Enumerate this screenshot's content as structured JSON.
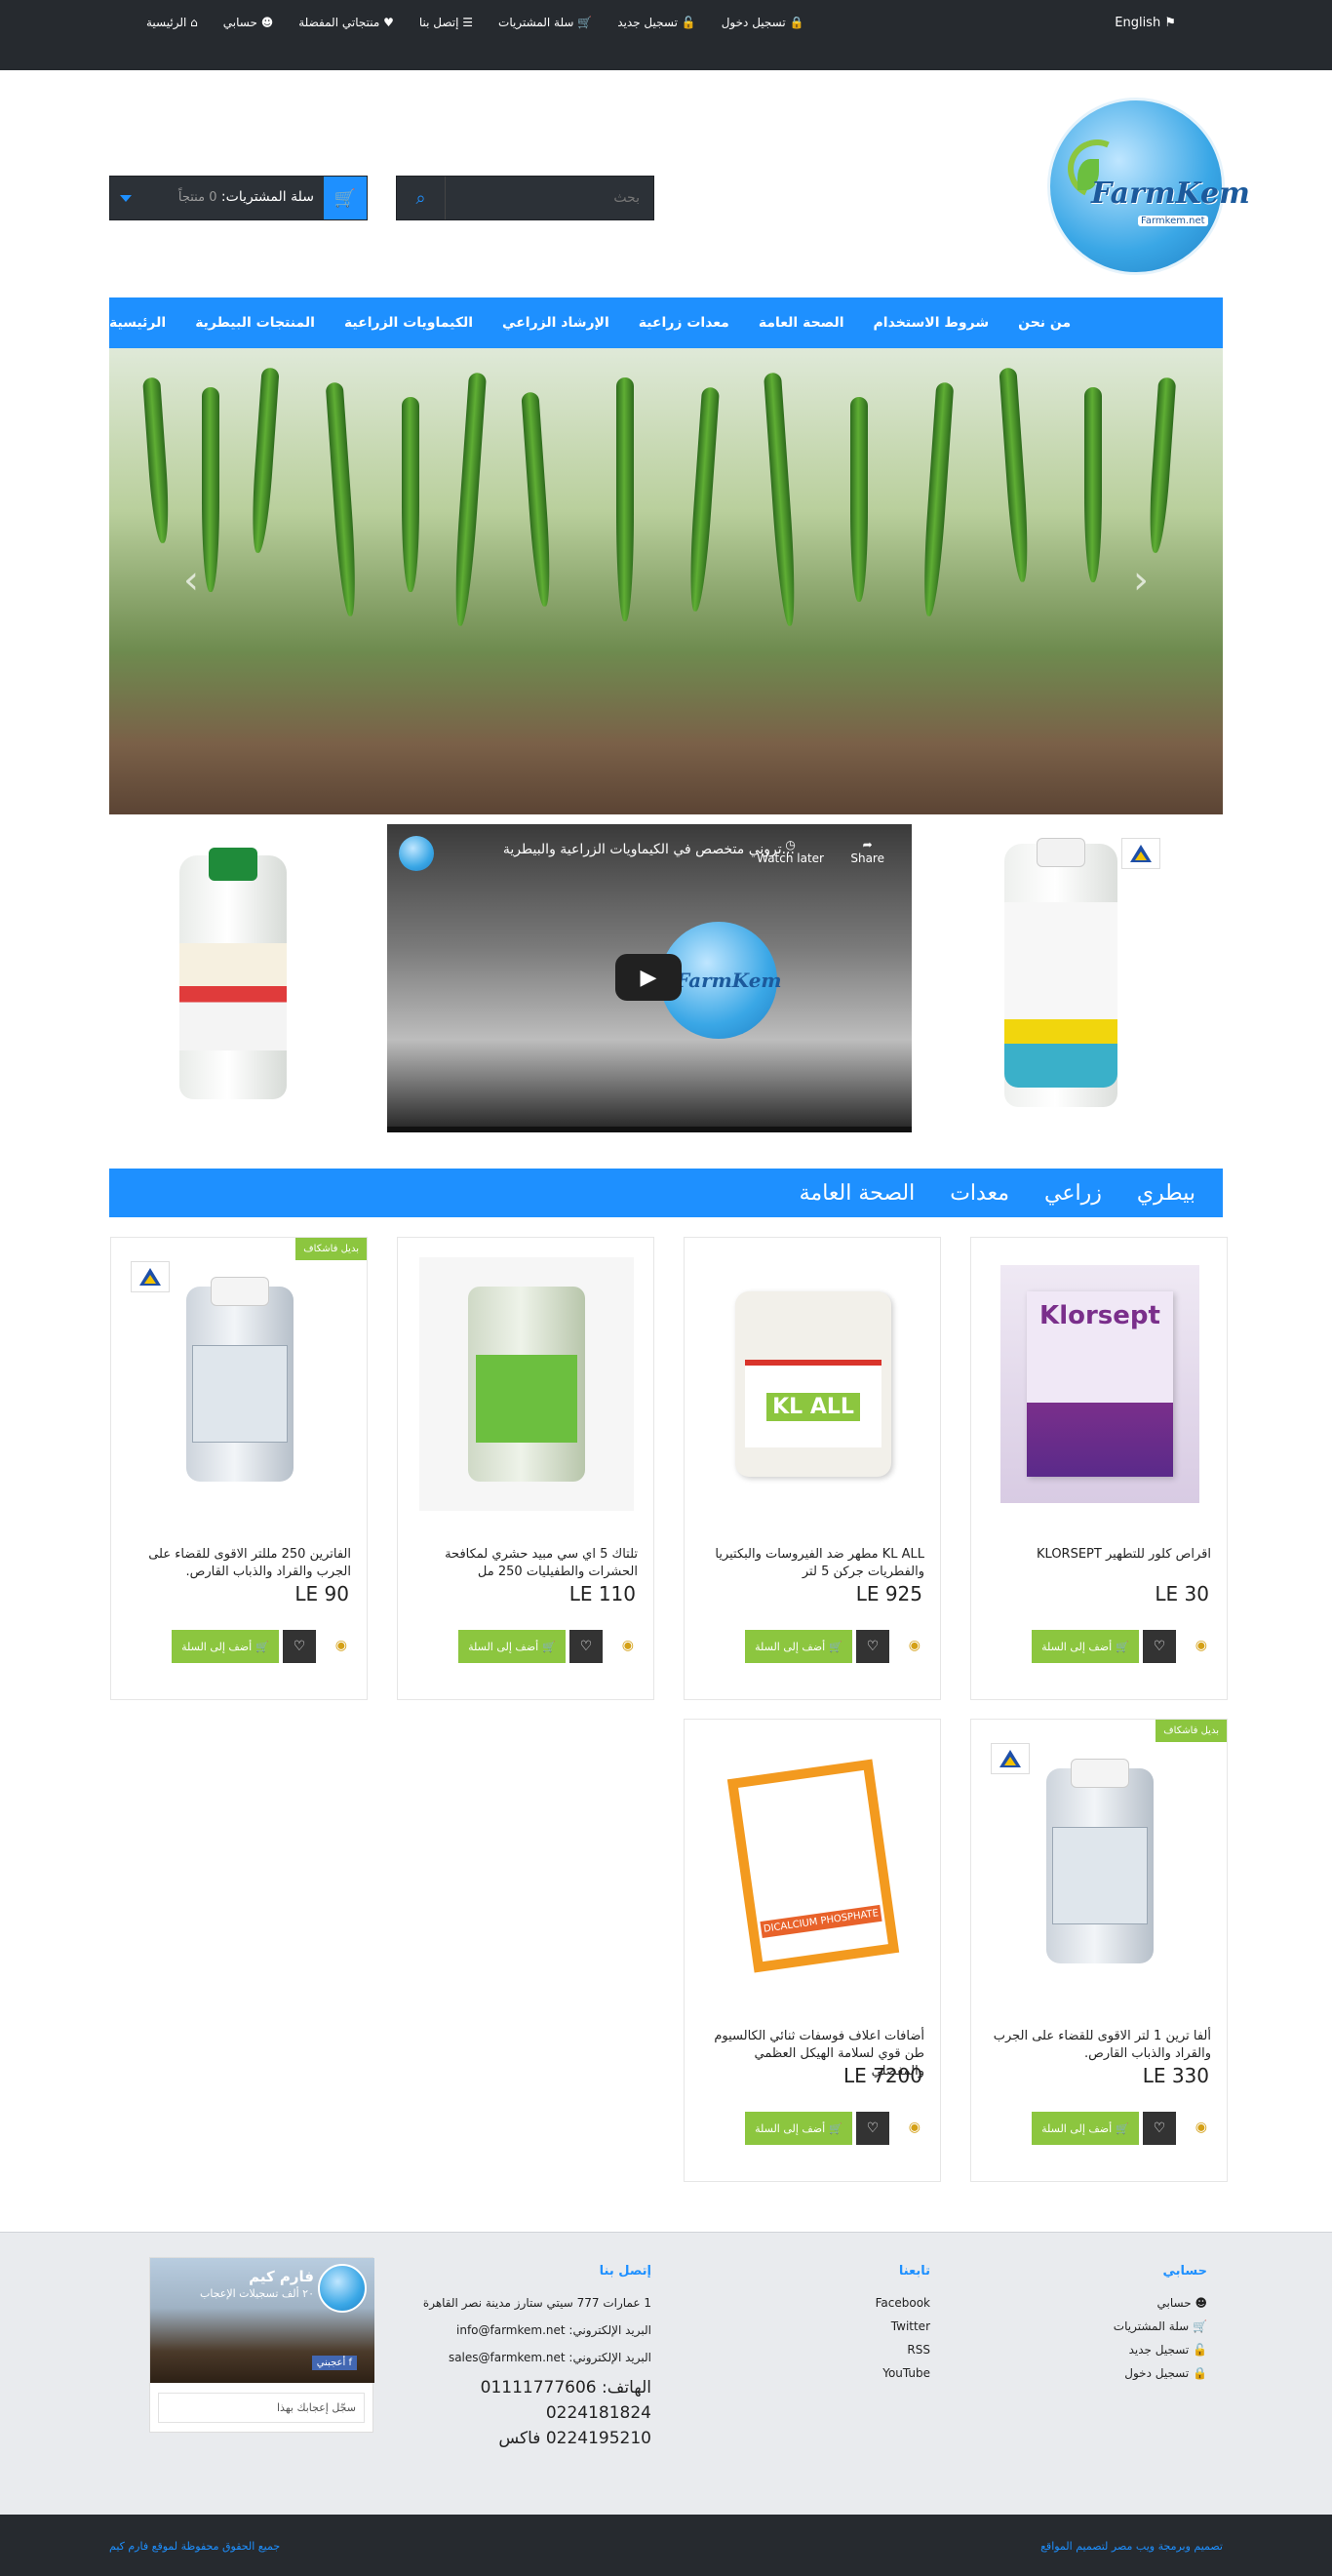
{
  "topbar": {
    "language": "English",
    "links": [
      {
        "label": "الرئيسية",
        "icon": "home-icon",
        "glyph": "⌂"
      },
      {
        "label": "حسابي",
        "icon": "user-icon",
        "glyph": "☻"
      },
      {
        "label": "منتجاتي المفضلة",
        "icon": "heart-icon",
        "glyph": "♥"
      },
      {
        "label": "إتصل بنا",
        "icon": "list-icon",
        "glyph": "☰"
      },
      {
        "label": "سلة المشتريات",
        "icon": "cart-icon",
        "glyph": "🛒"
      },
      {
        "label": "تسجيل جديد",
        "icon": "unlock-icon",
        "glyph": "🔓"
      },
      {
        "label": "تسجيل دخول",
        "icon": "lock-icon",
        "glyph": "🔒"
      }
    ]
  },
  "logo": {
    "text": "FarmKem",
    "subtext": "Farmkem.net"
  },
  "search": {
    "placeholder": "بحث"
  },
  "cart": {
    "label": "سلة المشتريات:",
    "count": "0 منتجاً"
  },
  "main_nav": [
    "الرئيسية",
    "المنتجات البيطرية",
    "الكيماويات الزراعية",
    "الإرشاد الزراعي",
    "معدات زراعية",
    "الصحة العامة",
    "شروط الاستخدام",
    "من نحن"
  ],
  "video": {
    "title": "...تروني متخصص في الكيماويات الزراعية والبيطرية",
    "watch_later": "Watch later",
    "share": "Share",
    "logo_text": "FarmKem"
  },
  "category_tabs": [
    "بيطري",
    "زراعي",
    "معدات",
    "الصحة العامة"
  ],
  "products": [
    {
      "name": "اقراص كلور للتطهير KLORSEPT",
      "price": "LE 30",
      "badge": "",
      "add_label": "أضف إلى السلة",
      "image_text": "Klorsept"
    },
    {
      "name": "KL ALL مطهر ضد الفيروسات والبكتيريا والفطريات جركن 5 لتر",
      "price": "LE 925",
      "badge": "",
      "add_label": "أضف إلى السلة",
      "image_text": "KL ALL"
    },
    {
      "name": "تلتاك 5 اي سي مبيد حشري لمكافحة الحشرات والطفيليات 250 مل",
      "price": "LE 110",
      "badge": "",
      "add_label": "أضف إلى السلة",
      "image_text": ""
    },
    {
      "name": "الفاترين 250 مللتر الاقوى للقضاء على الجرب والقراد والذباب القارص.",
      "price": "LE 90",
      "badge": "بديل فاشكاف",
      "add_label": "أضف إلى السلة",
      "image_text": ""
    },
    {
      "name": "ألفا ترين 1 لتر الاقوى للقضاء على الجرب والقراد والذباب القارص.",
      "price": "LE 330",
      "badge": "بديل فاشكاف",
      "add_label": "أضف إلى السلة",
      "image_text": ""
    },
    {
      "name": "أضافات اعلاف فوسفات ثنائي الكالسيوم طن قوي لسلامة الهيكل العظمي والمفصلي",
      "price": "LE 7200",
      "badge": "",
      "add_label": "أضف إلى السلة",
      "image_text": "DICALCIUM PHOSPHATE"
    }
  ],
  "footer": {
    "account": {
      "title": "حسابي",
      "links": [
        "حسابي",
        "سلة المشتريات",
        "تسجيل جديد",
        "تسجيل دخول"
      ]
    },
    "follow": {
      "title": "تابعنا",
      "links": [
        "Facebook",
        "Twitter",
        "RSS",
        "YouTube"
      ]
    },
    "contact": {
      "title": "إتصل بنا",
      "address": "1 عمارات 777 سيتي ستارز مدينة نصر القاهرة",
      "email1": "البريد الإلكتروني: info@farmkem.net",
      "email2": "البريد الإلكتروني: sales@farmkem.net",
      "phone1": "الهاتف: 01111777606",
      "phone2": "0224181824",
      "fax": "0224195210 فاكس"
    },
    "facebook": {
      "title": "فارم كيم",
      "subtitle": "٢٠ ألف تسجيلات الإعجاب",
      "like": "أعجبني",
      "note": "سجّل إعجابك بهذا"
    },
    "copyright": "جميع الحقوق محفوظة لموقع فارم كيم",
    "credit": "تصميم وبرمجة ويب مصر لتصميم المواقع"
  },
  "colors": {
    "brand_blue": "#1e90ff",
    "dark": "#262a2f",
    "green": "#8cc63f"
  }
}
